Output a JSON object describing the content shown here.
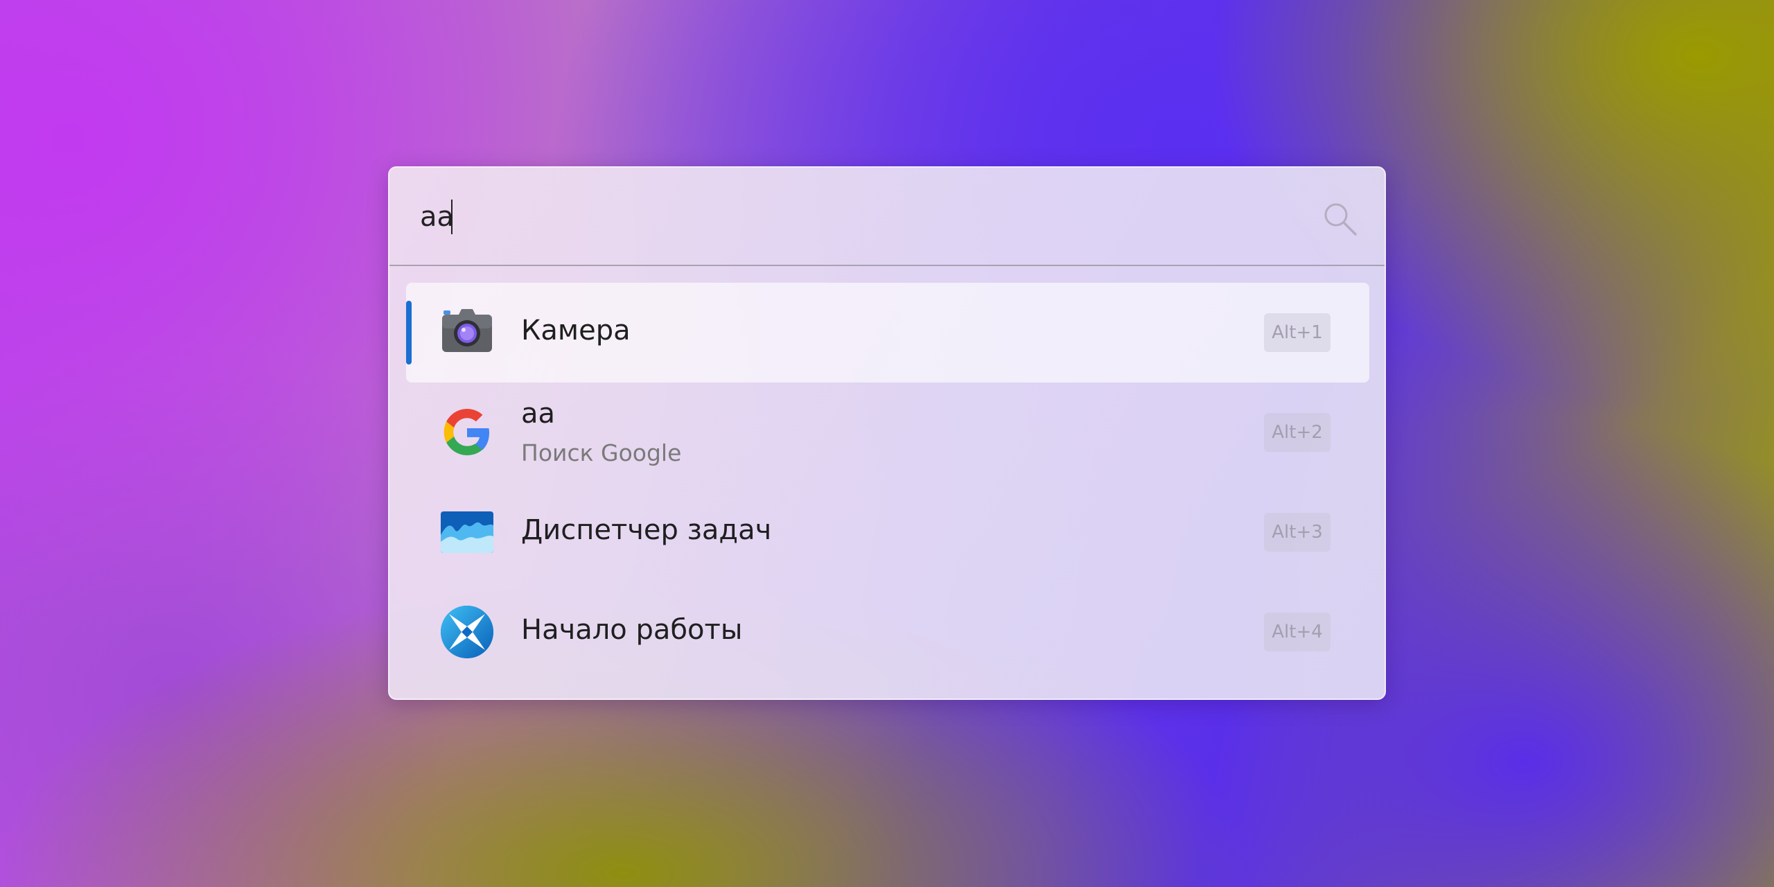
{
  "search": {
    "value": "aa"
  },
  "results": [
    {
      "title": "Камера",
      "subtitle": "",
      "hotkey": "Alt+1",
      "icon": "camera-icon",
      "selected": true
    },
    {
      "title": "aa",
      "subtitle": "Поиск Google",
      "hotkey": "Alt+2",
      "icon": "google-icon",
      "selected": false
    },
    {
      "title": "Диспетчер задач",
      "subtitle": "",
      "hotkey": "Alt+3",
      "icon": "task-manager-icon",
      "selected": false
    },
    {
      "title": "Начало работы",
      "subtitle": "",
      "hotkey": "Alt+4",
      "icon": "get-started-icon",
      "selected": false
    }
  ],
  "colors": {
    "accent": "#1a6fd0",
    "text": "#1f1f1f",
    "subtext": "#7a7a7a",
    "hotkey_text": "#a49eb0"
  }
}
